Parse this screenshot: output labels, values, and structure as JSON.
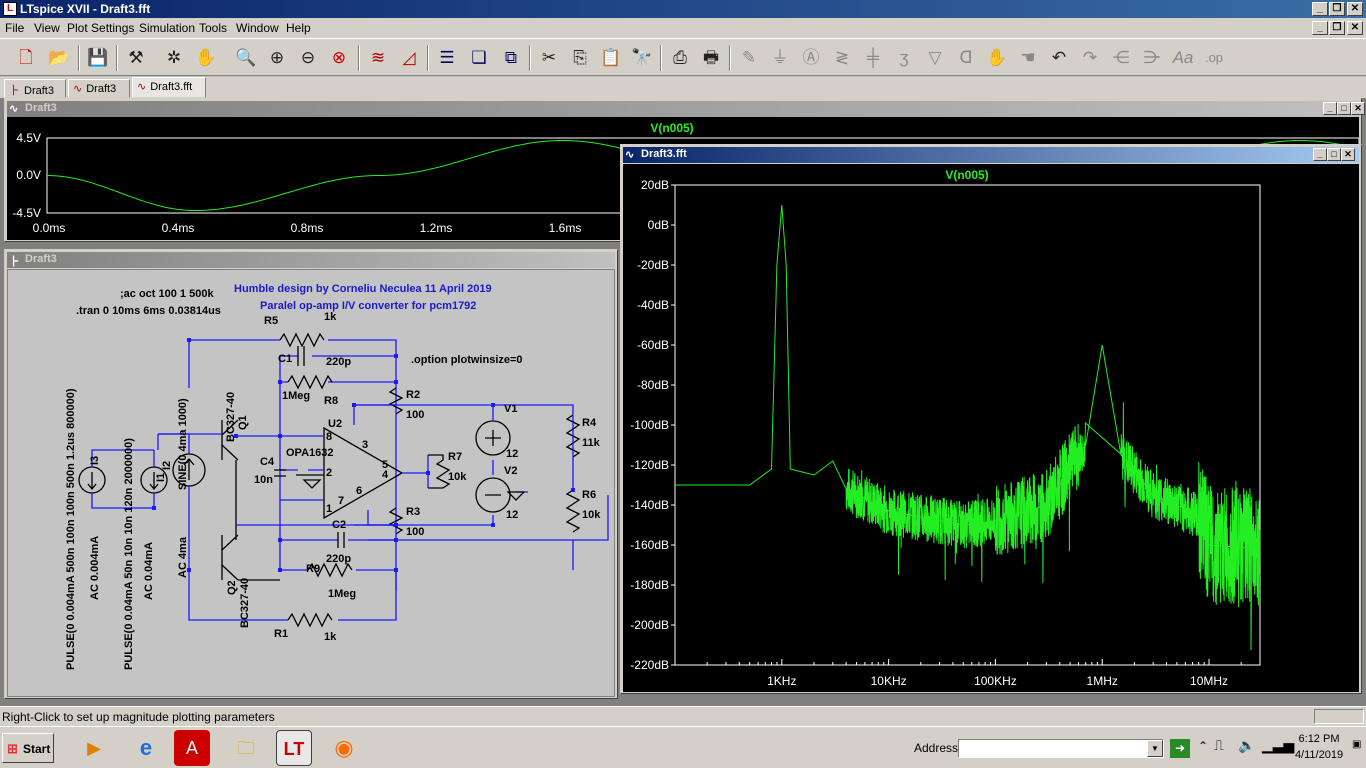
{
  "app": {
    "title": "LTspice XVII - Draft3.fft"
  },
  "menu": [
    "File",
    "View",
    "Plot Settings",
    "Simulation",
    "Tools",
    "Window",
    "Help"
  ],
  "tabs": [
    {
      "label": "Draft3",
      "icon": "schematic-icon"
    },
    {
      "label": "Draft3",
      "icon": "waveform-icon"
    },
    {
      "label": "Draft3.fft",
      "icon": "waveform-icon"
    }
  ],
  "transient_window": {
    "title": "Draft3",
    "trace": "V(n005)",
    "y_ticks": [
      "4.5V",
      "0.0V",
      "-4.5V"
    ],
    "x_ticks": [
      "0.0ms",
      "0.4ms",
      "0.8ms",
      "1.2ms",
      "1.6ms"
    ]
  },
  "schematic_window": {
    "title": "Draft3",
    "directives": {
      "ac": ";ac oct 100 1 500k",
      "tran": ".tran 0 10ms 6ms 0.03814us",
      "option": ".option plotwinsize=0"
    },
    "credits": {
      "line1": "Humble design by Corneliu Neculea 11 April 2019",
      "line2": "Paralel op-amp I/V converter  for pcm1792"
    },
    "labels": {
      "r5": "R5",
      "r5v": "1k",
      "c1": "C1",
      "c1v": "220p",
      "r8": "R8",
      "r8v": "1Meg",
      "r2": "R2",
      "r2v": "100",
      "r3": "R3",
      "r3v": "100",
      "r7": "R7",
      "r7v": "10k",
      "r4": "R4",
      "r4v": "11k",
      "r6": "R6",
      "r6v": "10k",
      "v1": "V1",
      "v1v": "12",
      "v2": "V2",
      "v2v": "12",
      "u2": "U2",
      "u2v": "OPA1632",
      "c4": "C4",
      "c4v": "10n",
      "c2": "C2",
      "c2v": "220p",
      "r9": "R9",
      "r9v": "1Meg",
      "r1": "R1",
      "r1v": "1k",
      "q1": "Q1",
      "q1v": "BC327-40",
      "q2": "Q2",
      "q2v": "BC327-40",
      "i3": "I3",
      "i3v": "PULSE(0 0.004mA 500n 100n 100n 500n 1.2us 800000)",
      "i3ac": "AC 0.004mA",
      "i1": "I1",
      "i1v": "PULSE(0 0.04mA 50n 10n 10n 120n 2000000)",
      "i1ac": "AC 0.04mA",
      "i2": "I2",
      "i2v": "SINE(0 4ma 1000)",
      "i2ac": "AC 4ma",
      "pin8": "8",
      "pin3": "3",
      "pin2": "2",
      "pin1": "1",
      "pin7": "7",
      "pin6": "6",
      "pin5": "5",
      "pin4": "4"
    }
  },
  "fft_window": {
    "title": "Draft3.fft",
    "trace": "V(n005)"
  },
  "chart_data": [
    {
      "type": "line",
      "title": "",
      "series": [
        {
          "name": "V(n005)",
          "x_ms": [
            0,
            0.2,
            0.45,
            0.7,
            0.95,
            1.2,
            1.45,
            1.7,
            1.95
          ],
          "values": [
            0,
            -4.2,
            0,
            4.2,
            0,
            -4.2,
            0,
            4.2,
            0
          ]
        }
      ],
      "xlabel": "",
      "ylabel": "",
      "xlim": [
        0,
        1.78
      ],
      "ylim": [
        -4.5,
        4.5
      ],
      "x_ticks": [
        "0.0ms",
        "0.4ms",
        "0.8ms",
        "1.2ms",
        "1.6ms"
      ],
      "y_ticks": [
        "4.5V",
        "0.0V",
        "-4.5V"
      ],
      "grid": false
    },
    {
      "type": "line",
      "title": "",
      "scale": "log-x",
      "series": [
        {
          "name": "V(n005)",
          "x_hz": [
            100,
            500,
            800,
            900,
            1000,
            1100,
            1200,
            2000,
            3000,
            4000,
            10000,
            50000,
            100000,
            300000,
            700000,
            1000000,
            1500000,
            3000000,
            8000000,
            10000000,
            30000000
          ],
          "values": [
            -130,
            -130,
            -122,
            -20,
            10,
            -20,
            -122,
            -125,
            -118,
            -132,
            -143,
            -150,
            -148,
            -140,
            -110,
            -60,
            -115,
            -135,
            -145,
            -160,
            -162
          ]
        }
      ],
      "xlabel": "",
      "ylabel": "",
      "xlim": [
        100,
        30000000
      ],
      "ylim": [
        -220,
        20
      ],
      "x_ticks": [
        "1KHz",
        "10KHz",
        "100KHz",
        "1MHz",
        "10MHz"
      ],
      "y_ticks": [
        "20dB",
        "0dB",
        "-20dB",
        "-40dB",
        "-60dB",
        "-80dB",
        "-100dB",
        "-120dB",
        "-140dB",
        "-160dB",
        "-180dB",
        "-200dB",
        "-220dB"
      ],
      "grid": false
    }
  ],
  "status": {
    "text": "Right-Click to set up magnitude plotting parameters"
  },
  "taskbar": {
    "start_label": "Start",
    "address_label": "Address",
    "address_value": "",
    "clock_time": "6:12 PM",
    "clock_date": "4/11/2019"
  },
  "colors": {
    "trace": "#22ee22",
    "plot_bg": "#000000",
    "wire": "#1a1aff",
    "text_blue": "#1a1acc"
  }
}
